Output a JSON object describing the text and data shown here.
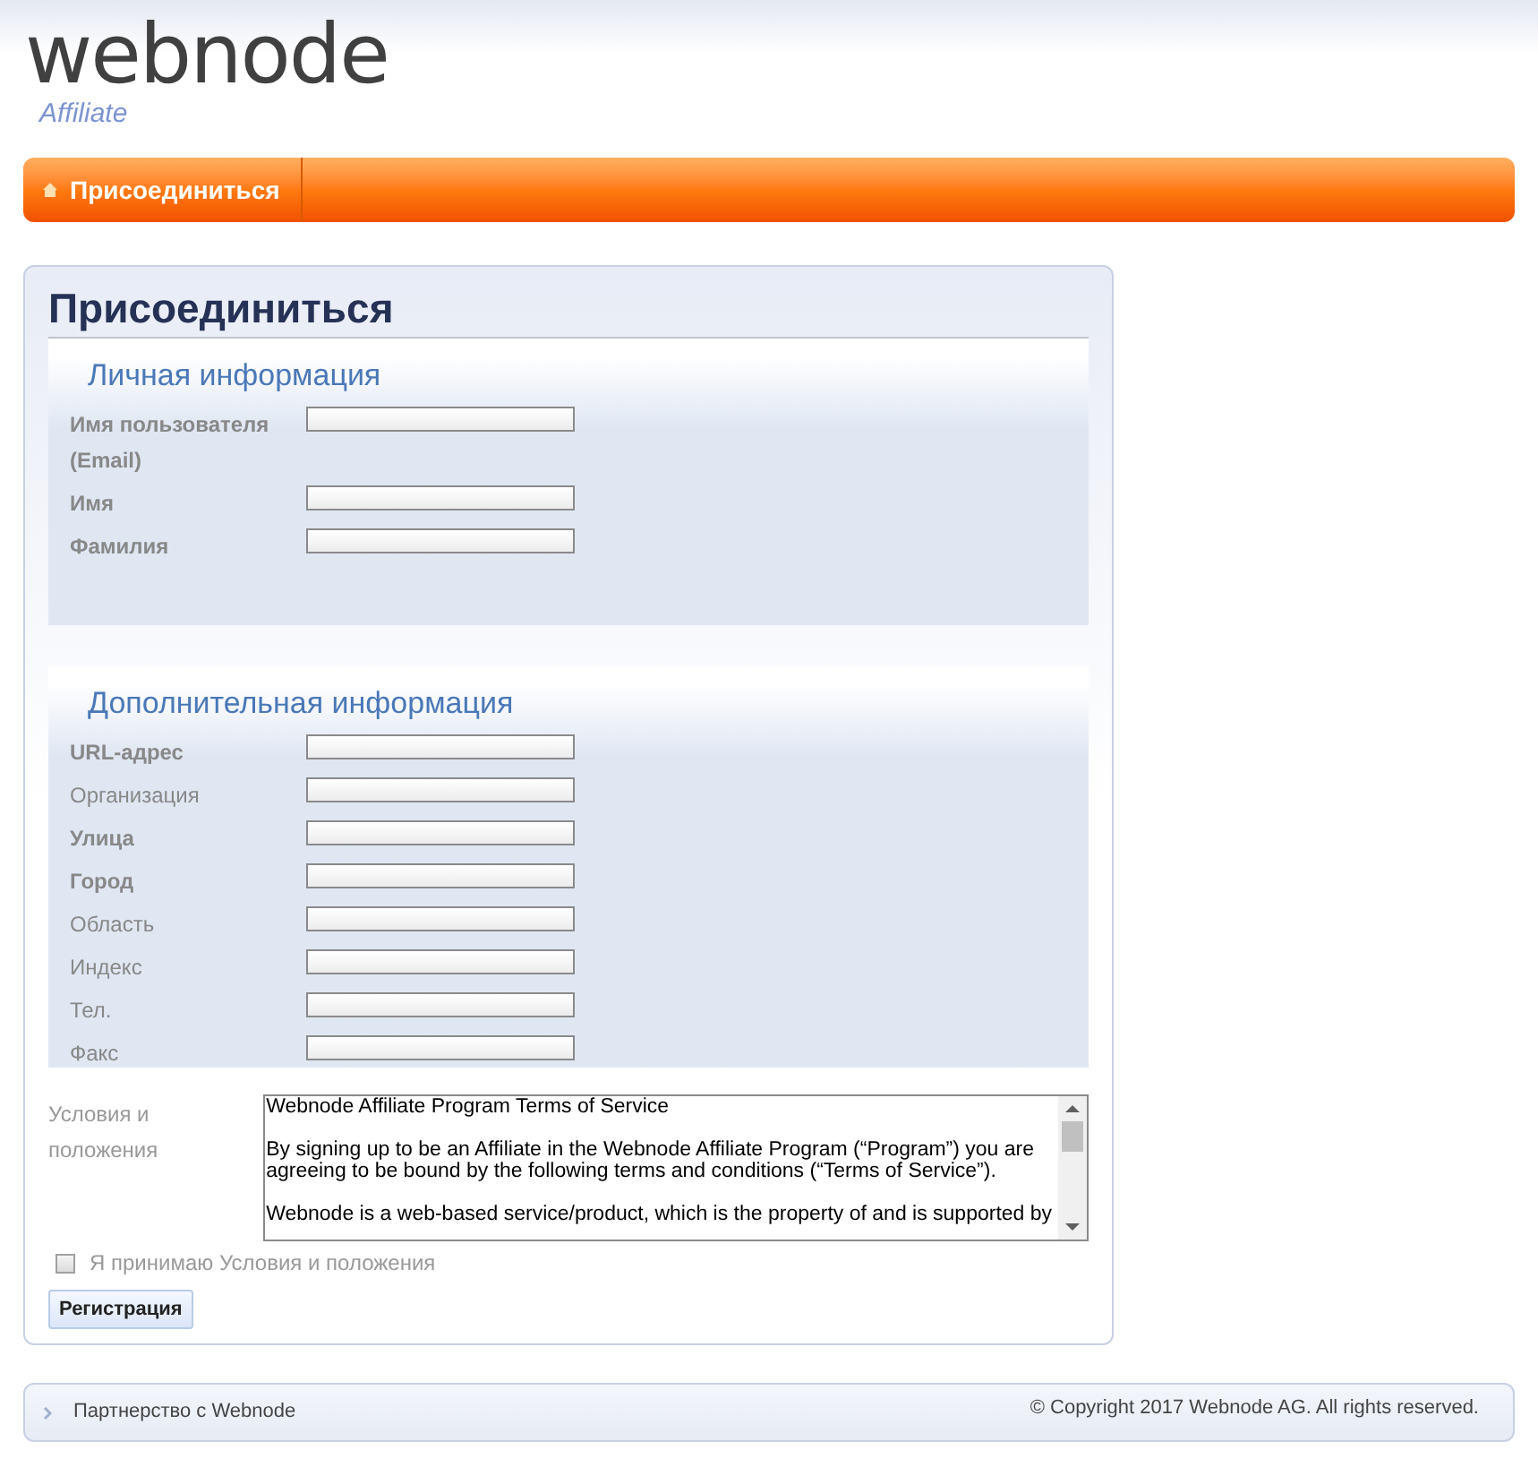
{
  "logo": {
    "wordmark": "webnode",
    "subtitle": "Affiliate"
  },
  "nav": {
    "items": [
      {
        "label": "Присоединиться",
        "selected": true
      }
    ]
  },
  "page_title": "Присоединиться",
  "sections": [
    {
      "title": "Личная информация",
      "fields": [
        {
          "label": "Имя пользователя (Email)",
          "required": true
        },
        {
          "label": "Имя",
          "required": true
        },
        {
          "label": "Фамилия",
          "required": true
        }
      ]
    },
    {
      "title": "Дополнительная информация",
      "fields": [
        {
          "label": "URL-адрес",
          "required": true
        },
        {
          "label": "Организация",
          "required": false
        },
        {
          "label": "Улица",
          "required": true
        },
        {
          "label": "Город",
          "required": true
        },
        {
          "label": "Область",
          "required": false
        },
        {
          "label": "Индекс",
          "required": false
        },
        {
          "label": "Тел.",
          "required": false
        },
        {
          "label": "Факс",
          "required": false
        }
      ]
    }
  ],
  "terms": {
    "label": "Условия и положения",
    "paragraphs": [
      "Webnode Affiliate Program Terms of Service",
      "By signing up to be an Affiliate in the Webnode Affiliate Program (“Program”) you are agreeing to be bound by the following terms and conditions (“Terms of Service”).",
      "Webnode is a web-based service/product, which is the property of and is supported by"
    ]
  },
  "accept": {
    "label": "Я принимаю Условия и положения",
    "checked": false
  },
  "submit": "Регистрация",
  "footer": {
    "link": "Партнерство с Webnode",
    "copyright": "© Copyright 2017 Webnode AG. All rights reserved."
  }
}
